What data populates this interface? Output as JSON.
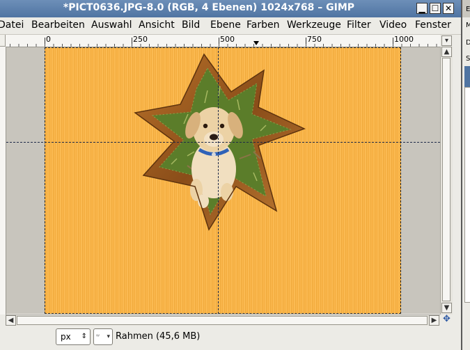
{
  "window": {
    "title": "*PICT0636.JPG-8.0 (RGB, 4 Ebenen) 1024x768 – GIMP",
    "buttons": {
      "minimize": "▁",
      "maximize": "☐",
      "close": "✕"
    }
  },
  "menu": [
    "Datei",
    "Bearbeiten",
    "Auswahl",
    "Ansicht",
    "Bild",
    "Ebene",
    "Farben",
    "Werkzeuge",
    "Filter",
    "Video",
    "Fenster"
  ],
  "ruler": {
    "labels": [
      "0",
      "250",
      "500",
      "750",
      "1000"
    ]
  },
  "status": {
    "unit": "px",
    "zoom_label": "ᵂ",
    "text": "Rahmen (45,6 MB)"
  },
  "right_panel": {
    "letters": [
      "E",
      "M",
      "D",
      "S"
    ]
  },
  "icons": {
    "menu_arrow": "▾",
    "scroll_up": "▲",
    "scroll_down": "▼",
    "scroll_left": "◀",
    "scroll_right": "▶",
    "navigate": "✥"
  },
  "colors": {
    "titlebar": "#5a7fad",
    "canvas_fill": "#f9b54a",
    "star_wood": "#9a5a1f",
    "guide": "#1e2a48"
  }
}
